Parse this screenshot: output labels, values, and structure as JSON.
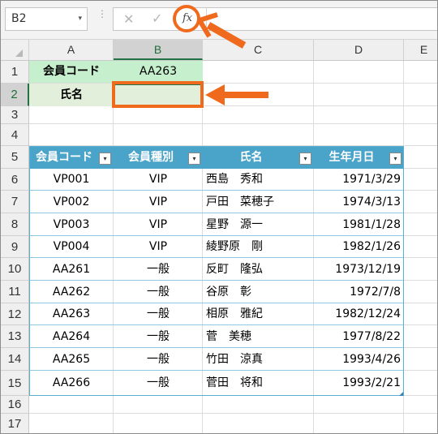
{
  "formula_bar": {
    "name_box": "B2",
    "name_box_arrow": "▾",
    "dots": "⋮",
    "cancel_glyph": "✕",
    "enter_glyph": "✓",
    "fx_label": "fx"
  },
  "columns": [
    "A",
    "B",
    "C",
    "D",
    "E"
  ],
  "rows": [
    "1",
    "2",
    "3",
    "4",
    "5",
    "6",
    "7",
    "8",
    "9",
    "10",
    "11",
    "12",
    "13",
    "14",
    "15",
    "16",
    "17"
  ],
  "selected": {
    "column": "B",
    "row": "2"
  },
  "lookup": {
    "a1": "会員コード",
    "b1": "AA263",
    "a2": "氏名",
    "b2": ""
  },
  "table": {
    "headers": [
      "会員コード",
      "会員種別",
      "氏名",
      "生年月日"
    ],
    "filter_glyph": "▾",
    "rows": [
      [
        "VP001",
        "VIP",
        "西島　秀和",
        "1971/3/29"
      ],
      [
        "VP002",
        "VIP",
        "戸田　菜穂子",
        "1974/3/13"
      ],
      [
        "VP003",
        "VIP",
        "星野　源一",
        "1981/1/28"
      ],
      [
        "VP004",
        "VIP",
        "綾野原　剛",
        "1982/1/26"
      ],
      [
        "AA261",
        "一般",
        "反町　隆弘",
        "1973/12/19"
      ],
      [
        "AA262",
        "一般",
        "谷原　彰",
        "1972/7/8"
      ],
      [
        "AA263",
        "一般",
        "相原　雅紀",
        "1982/12/24"
      ],
      [
        "AA264",
        "一般",
        "菅　美穂",
        "1977/8/22"
      ],
      [
        "AA265",
        "一般",
        "竹田　涼真",
        "1993/4/26"
      ],
      [
        "AA266",
        "一般",
        "菅田　将和",
        "1993/2/21"
      ]
    ]
  },
  "colors": {
    "accent_orange": "#f06a1e",
    "table_header": "#4aa3c8",
    "excel_green": "#217346",
    "label_fill": "#c6efce"
  },
  "icons": {
    "cancel": "close-icon",
    "enter": "check-icon",
    "fx": "insert-function-icon"
  }
}
